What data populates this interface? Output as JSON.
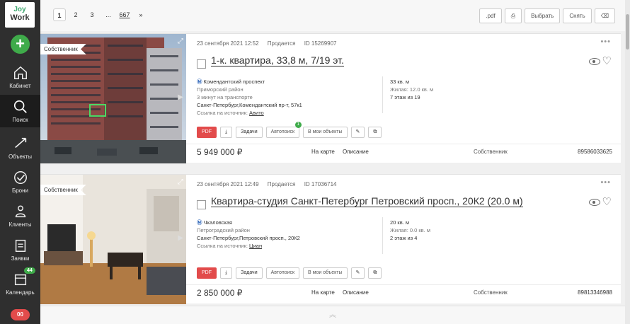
{
  "app": {
    "logo_line1": "Joy",
    "logo_line2": "Work",
    "add_label": "+"
  },
  "sidebar": {
    "items": [
      {
        "label": "Кабинет"
      },
      {
        "label": "Поиск"
      },
      {
        "label": "Объекты"
      },
      {
        "label": "Брони"
      },
      {
        "label": "Клиенты"
      },
      {
        "label": "Заявки"
      },
      {
        "label": "Календарь",
        "badge": "44"
      }
    ],
    "bottom_toggle": "00"
  },
  "pagination": {
    "pages": [
      "1",
      "2",
      "3",
      "...",
      "667",
      "»"
    ],
    "current": "1"
  },
  "toolbar": {
    "pdf": ".pdf",
    "select": "Выбрать",
    "clear": "Снять"
  },
  "listings": [
    {
      "owner_tag": "Собственник",
      "photo_caption": "",
      "date": "23 сентября 2021 12:52",
      "status": "Продается",
      "id": "ID 15269907",
      "title": "1-к. квартира, 33,8 м, 7/19 эт.",
      "metro": "Комендантский проспект",
      "district": "Приморский район",
      "transport": "3 минут на транспорте",
      "address": "Санкт-Петербург,Комендантский пр-т, 57к1",
      "source_label": "Ссылка на источник:",
      "source": "Авито",
      "area": "33 кв. м",
      "living": "Жилая: 12.0 кв. м",
      "floor": "7 этаж из 19",
      "actions": {
        "pdf": "PDF",
        "tasks": "Задачи",
        "autosearch": "Автопоиск",
        "autosearch_badge": "1",
        "my_objects": "В мои объекты"
      },
      "price": "5 949 000 ₽",
      "map_link": "На карте",
      "description_link": "Описание",
      "seller": "Собственник",
      "phone": "89586033625"
    },
    {
      "owner_tag": "Собственник",
      "photo_caption": "",
      "date": "23 сентября 2021 12:49",
      "status": "Продается",
      "id": "ID 17036714",
      "title": "Квартира-студия Санкт-Петербург Петровский просп., 20К2 (20.0 м)",
      "metro": "Чкаловская",
      "district": "Петроградский район",
      "transport": "",
      "address": "Санкт-Петербург,Петровский просп., 20К2",
      "source_label": "Ссылка на источник:",
      "source": "Циан",
      "area": "20 кв. м",
      "living": "Жилая: 0.0 кв. м",
      "floor": "2 этаж из 4",
      "actions": {
        "pdf": "PDF",
        "tasks": "Задачи",
        "autosearch": "Автопоиск",
        "autosearch_badge": "",
        "my_objects": "В мои объекты"
      },
      "price": "2 850 000 ₽",
      "map_link": "На карте",
      "description_link": "Описание",
      "seller": "Собственник",
      "phone": "89813346988"
    }
  ]
}
